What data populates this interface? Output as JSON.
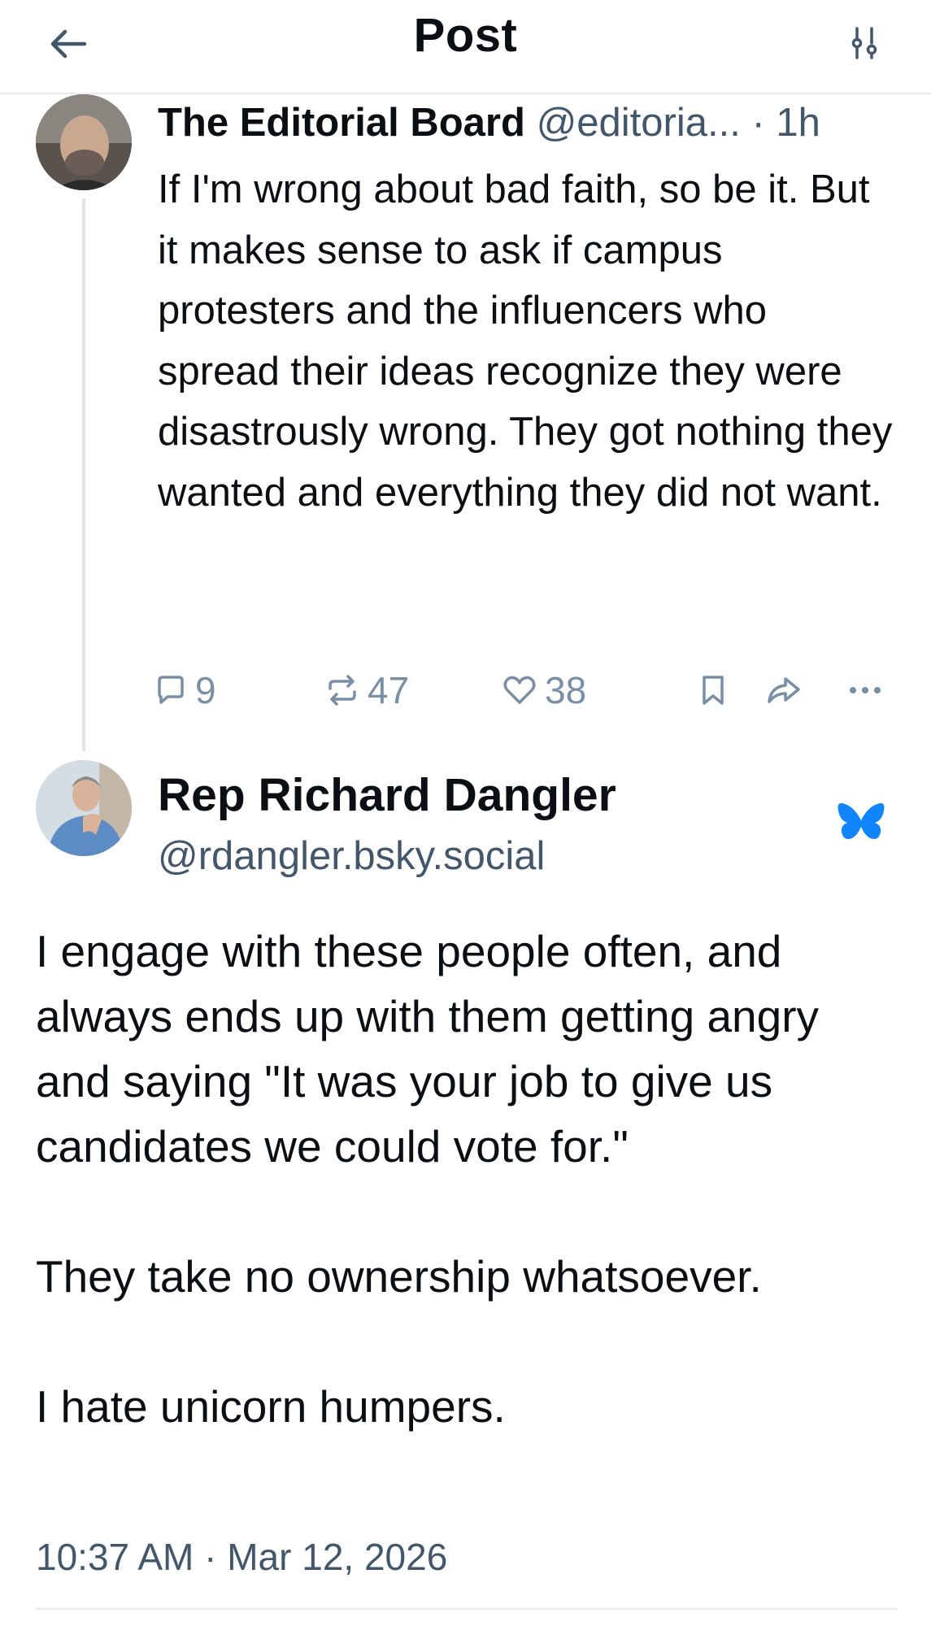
{
  "header": {
    "title": "Post"
  },
  "parent_post": {
    "author_name": "The Editorial Board",
    "author_handle": "@editoria...",
    "time": "· 1h",
    "text": "If I'm wrong about bad faith, so be it. But it makes sense to ask if campus protesters and the influencers who spread their ideas recognize they were disastrously wrong. They got nothing they wanted and everything they did not want.",
    "reply_count": "9",
    "repost_count": "47",
    "like_count": "38"
  },
  "main_post": {
    "author_name": "Rep Richard Dangler",
    "author_handle": "@rdangler.bsky.social",
    "paragraphs": [
      "I engage with these people often, and always ends up with them getting angry and saying \"It was your job to give us candidates we could vote for.\"",
      "They take no ownership whatsoever.",
      "I hate unicorn humpers."
    ],
    "timestamp": "10:37 AM · Mar 12, 2026"
  },
  "icons": {
    "back": "arrow-left-icon",
    "settings": "sliders-icon",
    "reply": "speech-bubble-icon",
    "repost": "repost-arrows-icon",
    "like": "heart-icon",
    "bookmark": "bookmark-icon",
    "share": "share-arrow-icon",
    "more": "ellipsis-icon",
    "brand": "bluesky-butterfly-icon"
  },
  "colors": {
    "text": "#0b0f14",
    "secondary": "#42576c",
    "action": "#788fa5",
    "brand": "#1185fe",
    "divider": "#e8ebef"
  }
}
